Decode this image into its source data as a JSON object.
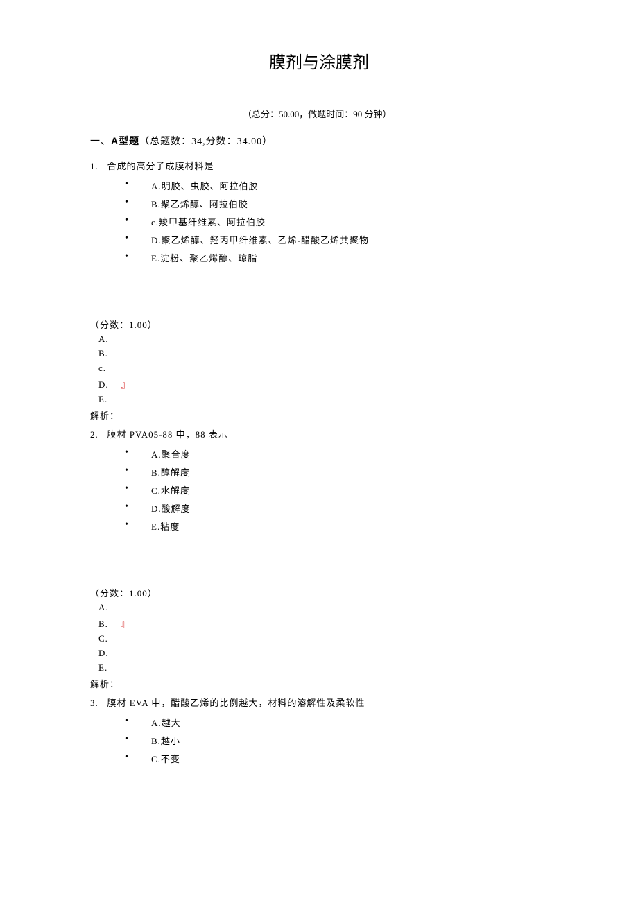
{
  "title": "膜剂与涂膜剂",
  "meta": "（总分：50.00，做题时间：90 分钟）",
  "section": {
    "prefix": "一、",
    "bold": "A型题",
    "rest": "（总题数：34,分数：34.00）"
  },
  "questions": [
    {
      "num": "1.",
      "stem": "合成的高分子成膜材料是",
      "options": [
        "A.明胶、虫胶、阿拉伯胶",
        "B.聚乙烯醇、阿拉伯胶",
        "c.羧甲基纤维素、阿拉伯胶",
        "D.聚乙烯醇、羟丙甲纤维素、乙烯-醋酸乙烯共聚物",
        "E.淀粉、聚乙烯醇、琼脂"
      ],
      "score": "（分数：1.00）",
      "answers": [
        "A.",
        "B.",
        "c.",
        "D.",
        "E."
      ],
      "correct": 3,
      "analysis": "解析："
    },
    {
      "num": "2.",
      "stem": "膜材 PVA05-88 中，88 表示",
      "options": [
        "A.聚合度",
        "B.醇解度",
        "C.水解度",
        "D.酸解度",
        "E.粘度"
      ],
      "score": "（分数：1.00）",
      "answers": [
        "A.",
        "B.",
        "C.",
        "D.",
        "E."
      ],
      "correct": 1,
      "analysis": "解析："
    },
    {
      "num": "3.",
      "stem": "膜材 EVA 中，醋酸乙烯的比例越大，材料的溶解性及柔软性",
      "options": [
        "A.越大",
        "B.越小",
        "C.不变"
      ]
    }
  ],
  "mark": "』"
}
